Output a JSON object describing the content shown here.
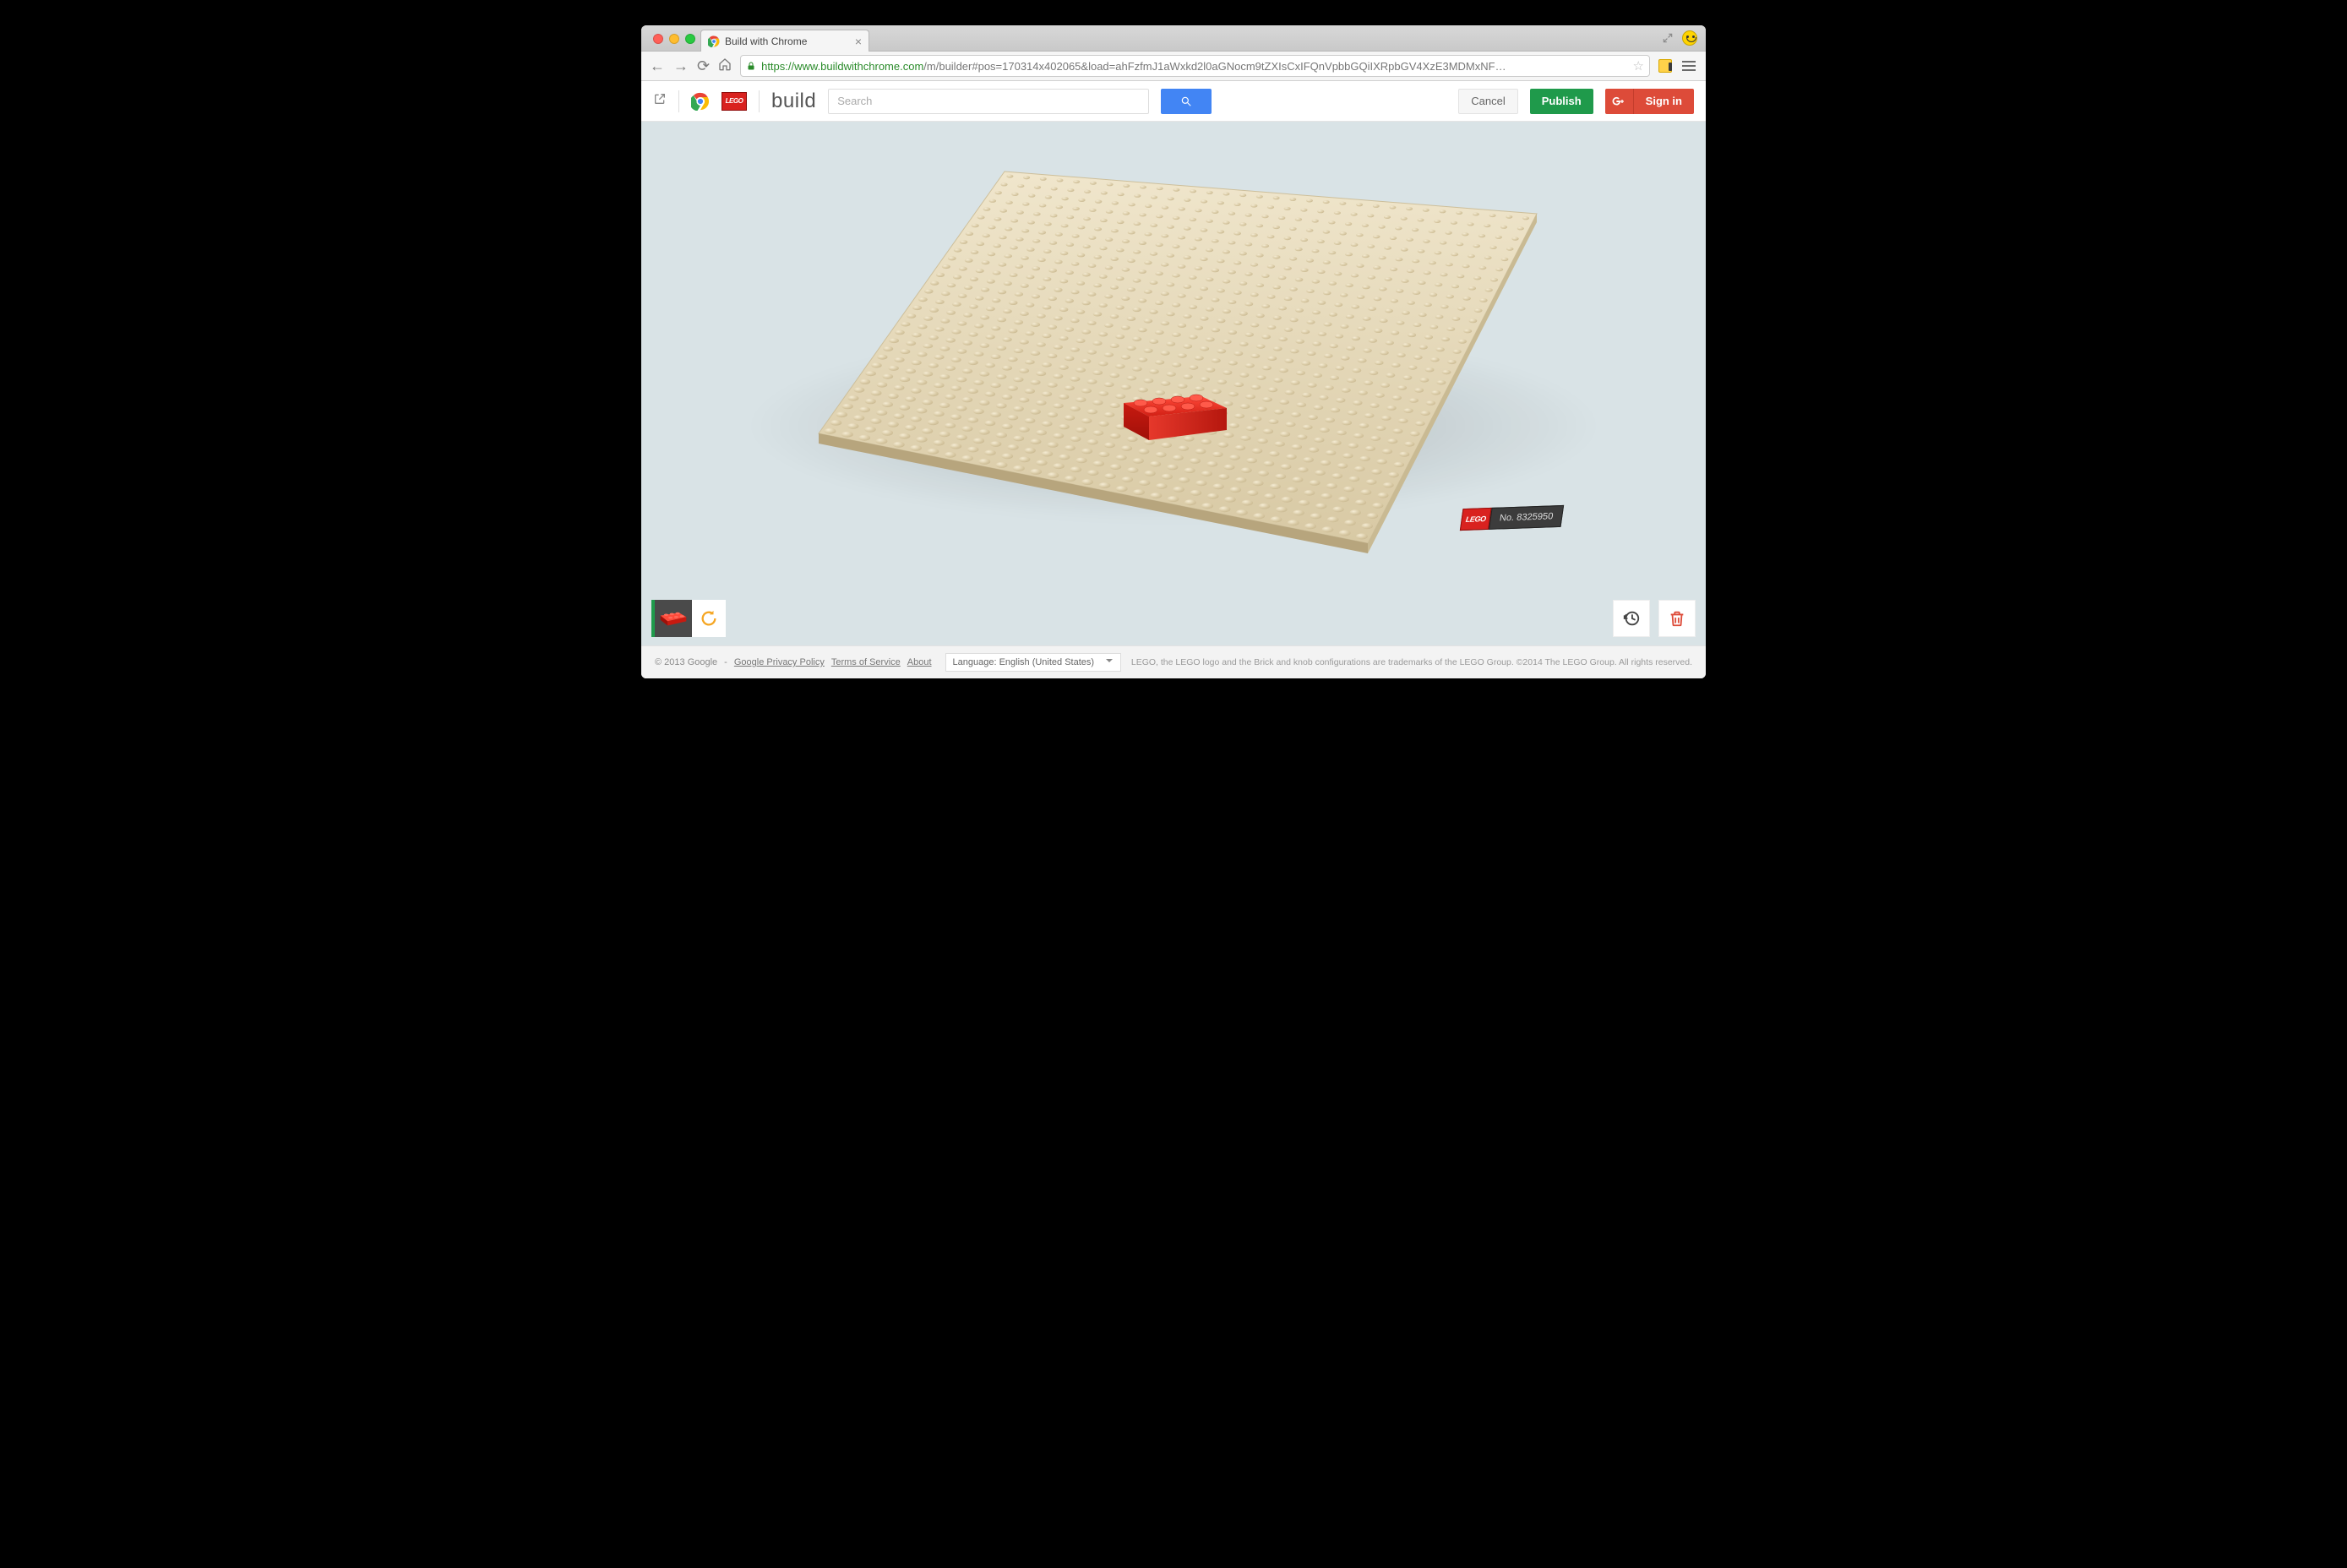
{
  "browser": {
    "tab_title": "Build with Chrome",
    "url_proto": "https",
    "url_host": "://www.buildwithchrome.com",
    "url_path": "/m/builder#pos=170314x402065&load=ahFzfmJ1aWxkd2l0aGNocm9tZXIsCxIFQnVpbbGQiIXRpbGV4XzE3MDMxNF…"
  },
  "header": {
    "build_label": "build",
    "lego_badge": "LEGO",
    "search_placeholder": "Search",
    "cancel": "Cancel",
    "publish": "Publish",
    "signin": "Sign in"
  },
  "build": {
    "number_prefix": "No.",
    "number": "8325950"
  },
  "footer": {
    "copyright": "© 2013 Google",
    "sep": "-",
    "privacy": "Google Privacy Policy",
    "terms": "Terms of Service",
    "about": "About",
    "language_label": "Language:",
    "language_value": "English (United States)",
    "legal": "LEGO, the LEGO logo and the Brick and knob configurations are trademarks of the LEGO Group. ©2014 The LEGO Group. All rights reserved."
  },
  "colors": {
    "publish": "#1f9a4b",
    "signin": "#dd4b39",
    "search": "#4285f4",
    "brick": "#d9221f",
    "board": "#e8dcc0"
  }
}
